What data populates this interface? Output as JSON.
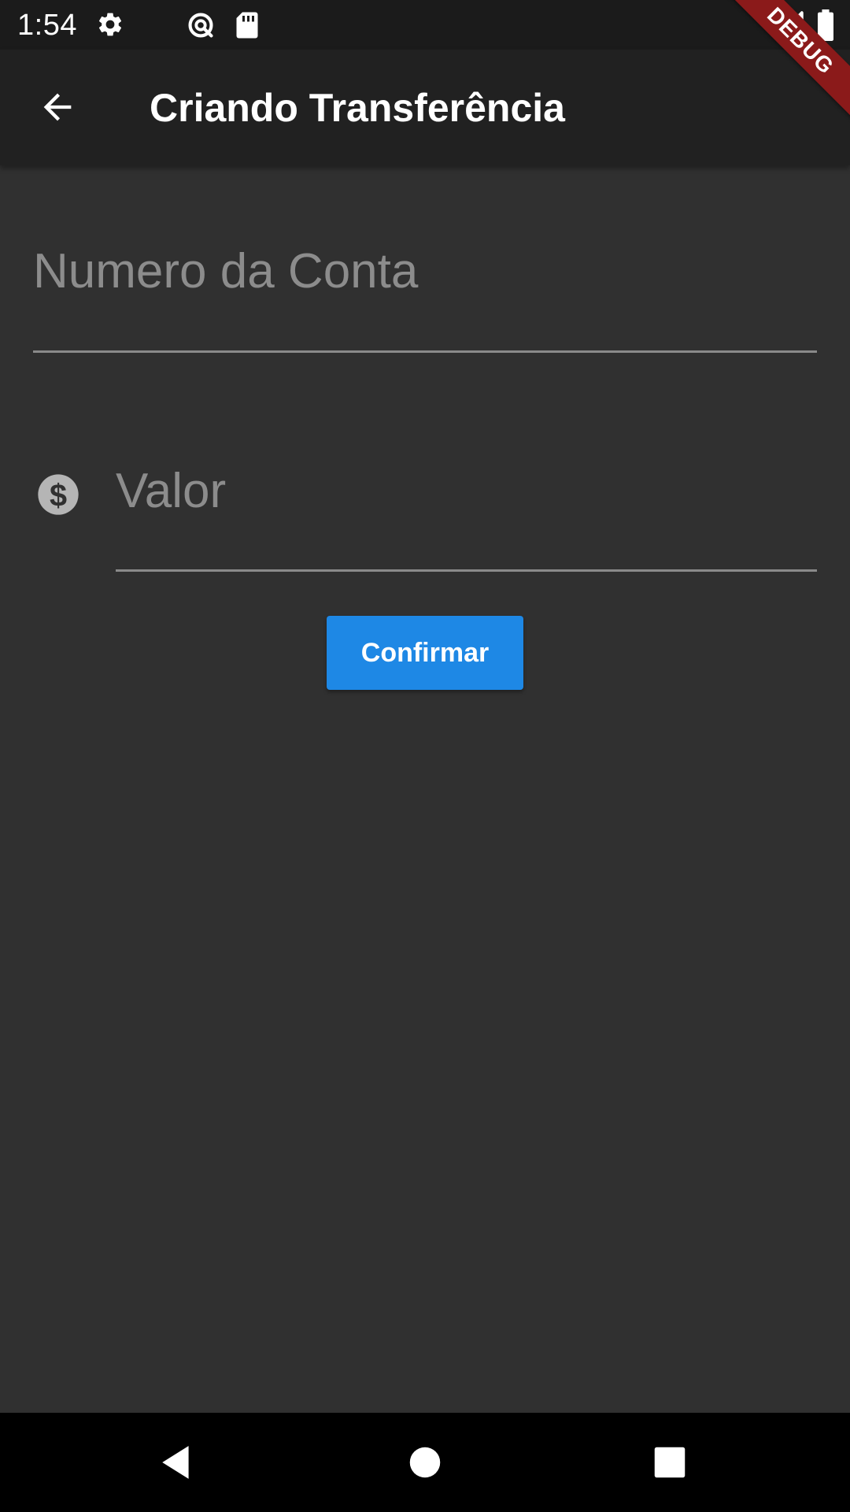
{
  "status_bar": {
    "time": "1:54",
    "icons": [
      "settings-icon",
      "data-saver-icon",
      "sd-card-icon",
      "signal-icon",
      "battery-icon"
    ]
  },
  "debug_banner": {
    "label": "DEBUG",
    "color": "#8b1a1a"
  },
  "app_bar": {
    "title": "Criando Transferência",
    "back_icon": "arrow-back-icon",
    "background": "#212121"
  },
  "form": {
    "account_field": {
      "placeholder": "Numero da Conta",
      "value": ""
    },
    "value_field": {
      "placeholder": "Valor",
      "value": "",
      "icon": "monetization-on-icon"
    },
    "confirm_button": {
      "label": "Confirmar",
      "color": "#1e88e5"
    }
  },
  "nav_bar": {
    "buttons": [
      "back-triangle-icon",
      "home-circle-icon",
      "recents-square-icon"
    ]
  },
  "colors": {
    "background": "#303030",
    "status_bar": "#1b1b1b",
    "underline": "#8a8a8a",
    "placeholder": "#8c8c8c"
  }
}
